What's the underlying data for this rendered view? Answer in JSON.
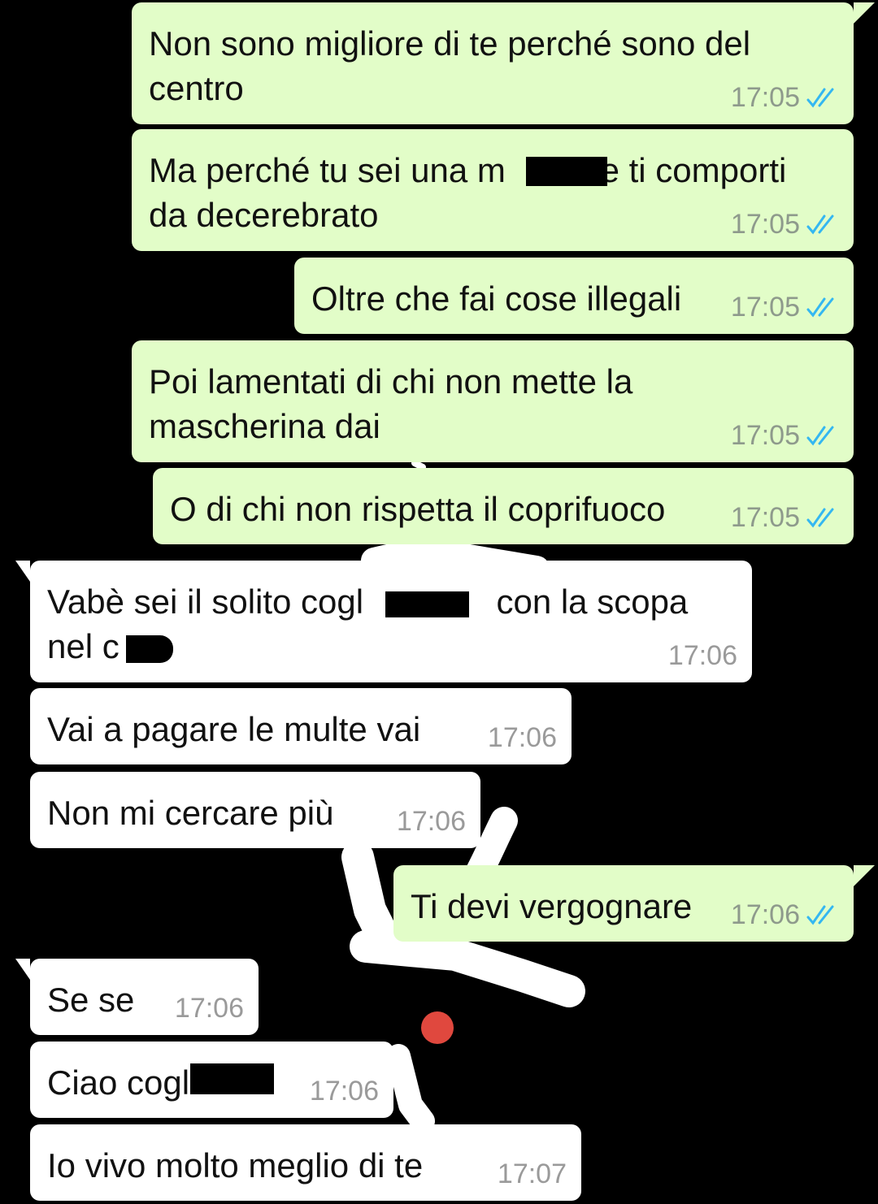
{
  "colors": {
    "background": "#000000",
    "outgoing_bubble": "#e2fdc8",
    "incoming_bubble": "#ffffff",
    "read_ticks": "#34b7f1",
    "timestamp": "#8e9a8c"
  },
  "messages": [
    {
      "direction": "out",
      "text": "Non sono migliore di te perché sono del\ncentro",
      "time": "17:05",
      "status": "read-ticks-icon"
    },
    {
      "direction": "out",
      "text": "Ma perché tu sei una m          e ti comporti\nda decerebrato",
      "time": "17:05",
      "status": "read-ticks-icon",
      "redacted": true
    },
    {
      "direction": "out",
      "text": "Oltre che fai cose illegali",
      "time": "17:05",
      "status": "read-ticks-icon"
    },
    {
      "direction": "out",
      "text": "Poi lamentati di chi non mette la\nmascherina dai",
      "time": "17:05",
      "status": "read-ticks-icon"
    },
    {
      "direction": "out",
      "text": "O di chi non rispetta il coprifuoco",
      "time": "17:05",
      "status": "read-ticks-icon"
    },
    {
      "direction": "in",
      "text": "Vabè sei il solito cogl              con la scopa\nnel c",
      "time": "17:06",
      "redacted": true
    },
    {
      "direction": "in",
      "text": "Vai a pagare le multe vai",
      "time": "17:06"
    },
    {
      "direction": "in",
      "text": "Non mi cercare più",
      "time": "17:06"
    },
    {
      "direction": "out",
      "text": "Ti devi vergognare",
      "time": "17:06",
      "status": "read-ticks-icon"
    },
    {
      "direction": "in",
      "text": "Se se",
      "time": "17:06"
    },
    {
      "direction": "in",
      "text": "Ciao cogl",
      "time": "17:06",
      "redacted": true
    },
    {
      "direction": "in",
      "text": "Io vivo molto meglio di te",
      "time": "17:07"
    }
  ]
}
